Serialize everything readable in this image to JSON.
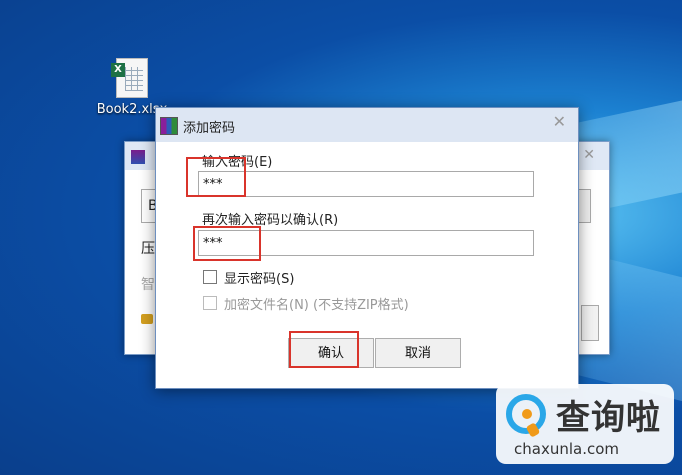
{
  "desktop": {
    "file_name": "Book2.xlsx"
  },
  "back_window": {
    "partial_input_text": "B",
    "partial_label_1": "压",
    "partial_label_2": "智"
  },
  "dialog": {
    "title": "添加密码",
    "close_glyph": "✕",
    "password_label": "输入密码(E)",
    "password_value": "***",
    "confirm_label": "再次输入密码以确认(R)",
    "confirm_value": "***",
    "show_password_label": "显示密码(S)",
    "show_password_checked": false,
    "encrypt_names_label": "加密文件名(N) (不支持ZIP格式)",
    "encrypt_names_checked": false,
    "encrypt_names_disabled": true,
    "ok_button": "确认",
    "cancel_button": "取消"
  },
  "watermark": {
    "brand_cn": "查询啦",
    "brand_url": "chaxunla.com"
  },
  "colors": {
    "highlight": "#d9342b",
    "desktop_bg": "#0b4ea6"
  }
}
